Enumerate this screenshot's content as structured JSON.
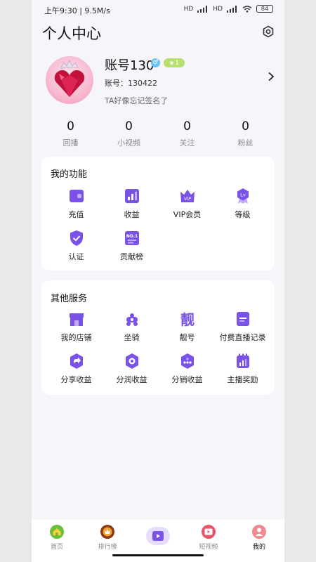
{
  "status_bar": {
    "time": "上午9:30 | 9.5M/s",
    "battery": "84",
    "signal1_label": "HD",
    "signal2_label": "HD"
  },
  "header": {
    "title": "个人中心",
    "settings_icon": "settings-hex-icon"
  },
  "profile": {
    "name": "账号130",
    "gender_symbol": "♂",
    "level": "1",
    "account_id": "账号：130422",
    "signature": "TA好像忘记签名了"
  },
  "stats": [
    {
      "value": "0",
      "label": "回播"
    },
    {
      "value": "0",
      "label": "小视频"
    },
    {
      "value": "0",
      "label": "关注"
    },
    {
      "value": "0",
      "label": "粉丝"
    }
  ],
  "my_functions": {
    "title": "我的功能",
    "items": [
      {
        "label": "充值",
        "icon": "wallet-icon"
      },
      {
        "label": "收益",
        "icon": "bar-chart-icon"
      },
      {
        "label": "VIP会员",
        "icon": "vip-crown-icon"
      },
      {
        "label": "等级",
        "icon": "level-medal-icon"
      },
      {
        "label": "认证",
        "icon": "shield-check-icon"
      },
      {
        "label": "贡献榜",
        "icon": "ranking-no1-icon"
      }
    ]
  },
  "other_services": {
    "title": "其他服务",
    "items": [
      {
        "label": "我的店铺",
        "icon": "shop-icon"
      },
      {
        "label": "坐骑",
        "icon": "mount-icon"
      },
      {
        "label": "靓号",
        "icon": "pretty-number-icon",
        "glyph": "靓"
      },
      {
        "label": "付费直播记录",
        "icon": "record-icon"
      },
      {
        "label": "分享收益",
        "icon": "share-icon"
      },
      {
        "label": "分润收益",
        "icon": "profit-share-icon"
      },
      {
        "label": "分销收益",
        "icon": "distribution-icon"
      },
      {
        "label": "主播奖励",
        "icon": "calendar-reward-icon"
      }
    ]
  },
  "tabbar": {
    "items": [
      {
        "label": "首页",
        "icon": "home-icon"
      },
      {
        "label": "排行榜",
        "icon": "ranking-icon"
      },
      {
        "label": "",
        "icon": "live-play-icon"
      },
      {
        "label": "短视频",
        "icon": "short-video-icon"
      },
      {
        "label": "我的",
        "icon": "profile-icon",
        "active": true
      }
    ]
  },
  "colors": {
    "accent": "#7b52e8",
    "background": "#f6f5fa"
  }
}
